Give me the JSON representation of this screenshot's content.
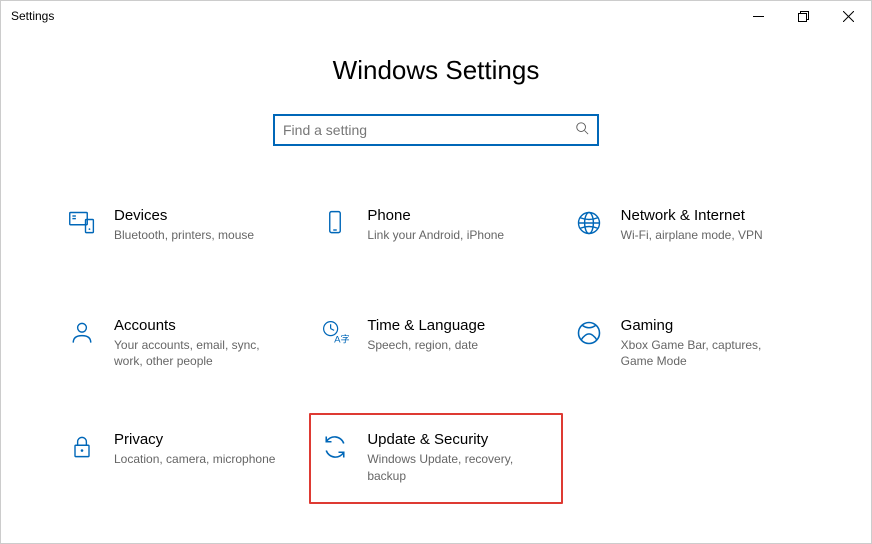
{
  "window": {
    "title": "Settings"
  },
  "page": {
    "heading": "Windows Settings"
  },
  "search": {
    "placeholder": "Find a setting",
    "value": ""
  },
  "tiles": [
    {
      "icon": "devices",
      "title": "Devices",
      "desc": "Bluetooth, printers, mouse"
    },
    {
      "icon": "phone",
      "title": "Phone",
      "desc": "Link your Android, iPhone"
    },
    {
      "icon": "network",
      "title": "Network & Internet",
      "desc": "Wi-Fi, airplane mode, VPN"
    },
    {
      "icon": "accounts",
      "title": "Accounts",
      "desc": "Your accounts, email, sync, work, other people"
    },
    {
      "icon": "time",
      "title": "Time & Language",
      "desc": "Speech, region, date"
    },
    {
      "icon": "gaming",
      "title": "Gaming",
      "desc": "Xbox Game Bar, captures, Game Mode"
    },
    {
      "icon": "privacy",
      "title": "Privacy",
      "desc": "Location, camera, microphone"
    },
    {
      "icon": "update",
      "title": "Update & Security",
      "desc": "Windows Update, recovery, backup",
      "highlighted": true
    }
  ],
  "colors": {
    "accent": "#0067b8",
    "highlight_border": "#de3a33"
  }
}
